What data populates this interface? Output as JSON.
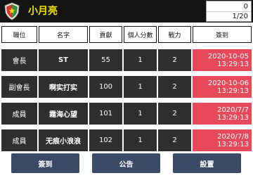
{
  "header": {
    "title": "小月亮",
    "counter_top": "0",
    "counter_bottom": "1/20"
  },
  "table": {
    "columns": [
      "職位",
      "名字",
      "貢獻",
      "個人分數",
      "戰力",
      "簽到"
    ],
    "rows": [
      {
        "position": "會長",
        "name": "ST",
        "contribution": "55",
        "score": "1",
        "power": "2",
        "date": "2020-10-05",
        "time": "13:29:13"
      },
      {
        "position": "副會長",
        "name": "啊实打实",
        "contribution": "100",
        "score": "1",
        "power": "2",
        "date": "2020-10-06",
        "time": "13:29:13"
      },
      {
        "position": "成員",
        "name": "霜海心望",
        "contribution": "101",
        "score": "1",
        "power": "2",
        "date": "2020/7/7",
        "time": "13:29:13"
      },
      {
        "position": "成員",
        "name": "无痕小浪浪",
        "contribution": "102",
        "score": "1",
        "power": "2",
        "date": "2020/7/8",
        "time": "13:29:13"
      }
    ]
  },
  "footer": {
    "checkin_label": "簽到",
    "announce_label": "公告",
    "settings_label": "設置"
  },
  "colors": {
    "header_bg": "#141414",
    "title": "#f2e200",
    "row_bg": "#2f2f2f",
    "date_bg": "#e8495a",
    "button_bg": "#3b4a66"
  },
  "icons": {
    "logo": "guild-shield-icon"
  }
}
